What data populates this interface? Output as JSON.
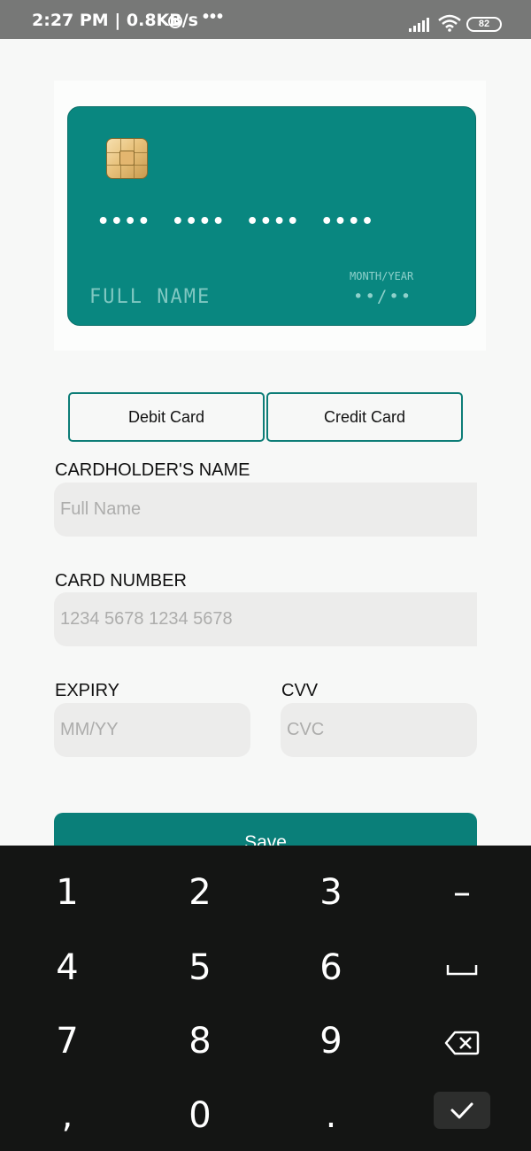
{
  "status_bar": {
    "time": "2:27 PM | 0.8KB/s",
    "overflow": "•••",
    "battery": "82",
    "icons": [
      "alarm-icon",
      "signal-icon",
      "wifi-icon",
      "battery-icon"
    ]
  },
  "card_preview": {
    "number": "•••• •••• •••• ••••",
    "holder": "FULL NAME",
    "expiry_label": "MONTH/YEAR",
    "expiry_value": "••/••",
    "color": "#098780"
  },
  "card_type": {
    "options": [
      "Debit Card",
      "Credit Card"
    ]
  },
  "form": {
    "name_label": "CARDHOLDER'S NAME",
    "name_placeholder": "Full Name",
    "number_label": "CARD NUMBER",
    "number_placeholder": "1234 5678 1234 5678",
    "expiry_label": "EXPIRY",
    "expiry_placeholder": "MM/YY",
    "cvv_label": "CVV",
    "cvv_placeholder": "CVC",
    "save_label": "Save"
  },
  "keyboard": {
    "keys": [
      "1",
      "2",
      "3",
      "–",
      "4",
      "5",
      "6",
      "7",
      "8",
      "9",
      ",",
      "0",
      "."
    ],
    "special": [
      "space-icon",
      "backspace-icon",
      "enter-check-icon"
    ]
  },
  "colors": {
    "accent": "#0a7f79",
    "field_bg": "#ececeb",
    "keyboard_bg": "#141514"
  }
}
